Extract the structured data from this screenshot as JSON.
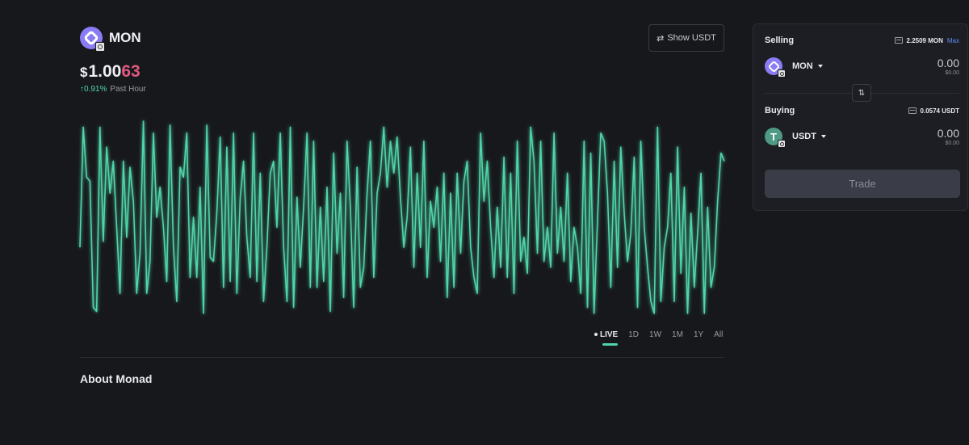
{
  "token": {
    "symbol": "MON",
    "price_currency": "$",
    "price_main": "1.00",
    "price_tail": "63",
    "change_pct": "↑0.91%",
    "change_period": "Past Hour",
    "about_title": "About Monad"
  },
  "header": {
    "show_usdt_icon": "⇄",
    "show_usdt_label": "Show USDT"
  },
  "timeframes": [
    "LIVE",
    "1D",
    "1W",
    "1M",
    "1Y",
    "All"
  ],
  "active_timeframe": "LIVE",
  "trade": {
    "selling_label": "Selling",
    "selling_balance": "2.2509 MON",
    "max_label": "Max",
    "sell_asset": "MON",
    "sell_amount": "0.00",
    "sell_usd": "$0.00",
    "swap_icon": "⇅",
    "buying_label": "Buying",
    "buying_balance": "0.0574 USDT",
    "buy_asset": "USDT",
    "buy_logo_letter": "T",
    "buy_amount": "0.00",
    "buy_usd": "$0.00",
    "trade_button": "Trade"
  },
  "colors": {
    "line": "#4fd6a8",
    "price_tail": "#e0587e",
    "accent_link": "#5d8ff5"
  },
  "chart_data": {
    "type": "line",
    "series": [
      {
        "values": [
          0.35,
          0.95,
          0.7,
          0.68,
          0.05,
          0.03,
          0.95,
          0.38,
          0.85,
          0.62,
          0.78,
          0.45,
          0.12,
          0.78,
          0.4,
          0.75,
          0.58,
          0.12,
          0.32,
          0.98,
          0.12,
          0.28,
          0.92,
          0.5,
          0.65,
          0.45,
          0.18,
          0.96,
          0.35,
          0.08,
          0.75,
          0.7,
          0.92,
          0.2,
          0.5,
          0.2,
          0.65,
          0.02,
          0.96,
          0.3,
          0.28,
          0.52,
          0.9,
          0.15,
          0.85,
          0.18,
          0.92,
          0.12,
          0.6,
          0.78,
          0.4,
          0.2,
          0.92,
          0.18,
          0.72,
          0.08,
          0.35,
          0.72,
          0.78,
          0.45,
          0.92,
          0.35,
          0.08,
          0.95,
          0.05,
          0.6,
          0.25,
          0.55,
          0.92,
          0.15,
          0.88,
          0.15,
          0.55,
          0.18,
          0.65,
          0.03,
          0.82,
          0.32,
          0.62,
          0.1,
          0.88,
          0.55,
          0.05,
          0.75,
          0.15,
          0.25,
          0.62,
          0.88,
          0.2,
          0.62,
          0.72,
          0.95,
          0.65,
          0.88,
          0.72,
          0.9,
          0.6,
          0.35,
          0.5,
          0.85,
          0.25,
          0.72,
          0.35,
          0.88,
          0.2,
          0.58,
          0.45,
          0.65,
          0.28,
          0.72,
          0.1,
          0.62,
          0.15,
          0.72,
          0.32,
          0.68,
          0.78,
          0.35,
          0.2,
          0.12,
          0.92,
          0.58,
          0.78,
          0.45,
          0.2,
          0.55,
          0.25,
          0.8,
          0.2,
          0.72,
          0.12,
          0.88,
          0.28,
          0.4,
          0.22,
          0.95,
          0.78,
          0.32,
          0.88,
          0.28,
          0.45,
          0.25,
          0.92,
          0.32,
          0.55,
          0.28,
          0.72,
          0.18,
          0.45,
          0.35,
          0.12,
          0.88,
          0.05,
          0.82,
          0.02,
          0.48,
          0.92,
          0.88,
          0.62,
          0.15,
          0.78,
          0.25,
          0.85,
          0.52,
          0.28,
          0.42,
          0.8,
          0.05,
          0.88,
          0.45,
          0.25,
          0.08,
          0.02,
          0.95,
          0.08,
          0.35,
          0.45,
          0.72,
          0.08,
          0.85,
          0.22,
          0.65,
          0.02,
          0.52,
          0.15,
          0.42,
          0.72,
          0.02,
          0.55,
          0.15,
          0.25,
          0.58,
          0.82,
          0.78
        ]
      }
    ],
    "grid": false,
    "legend": false
  }
}
